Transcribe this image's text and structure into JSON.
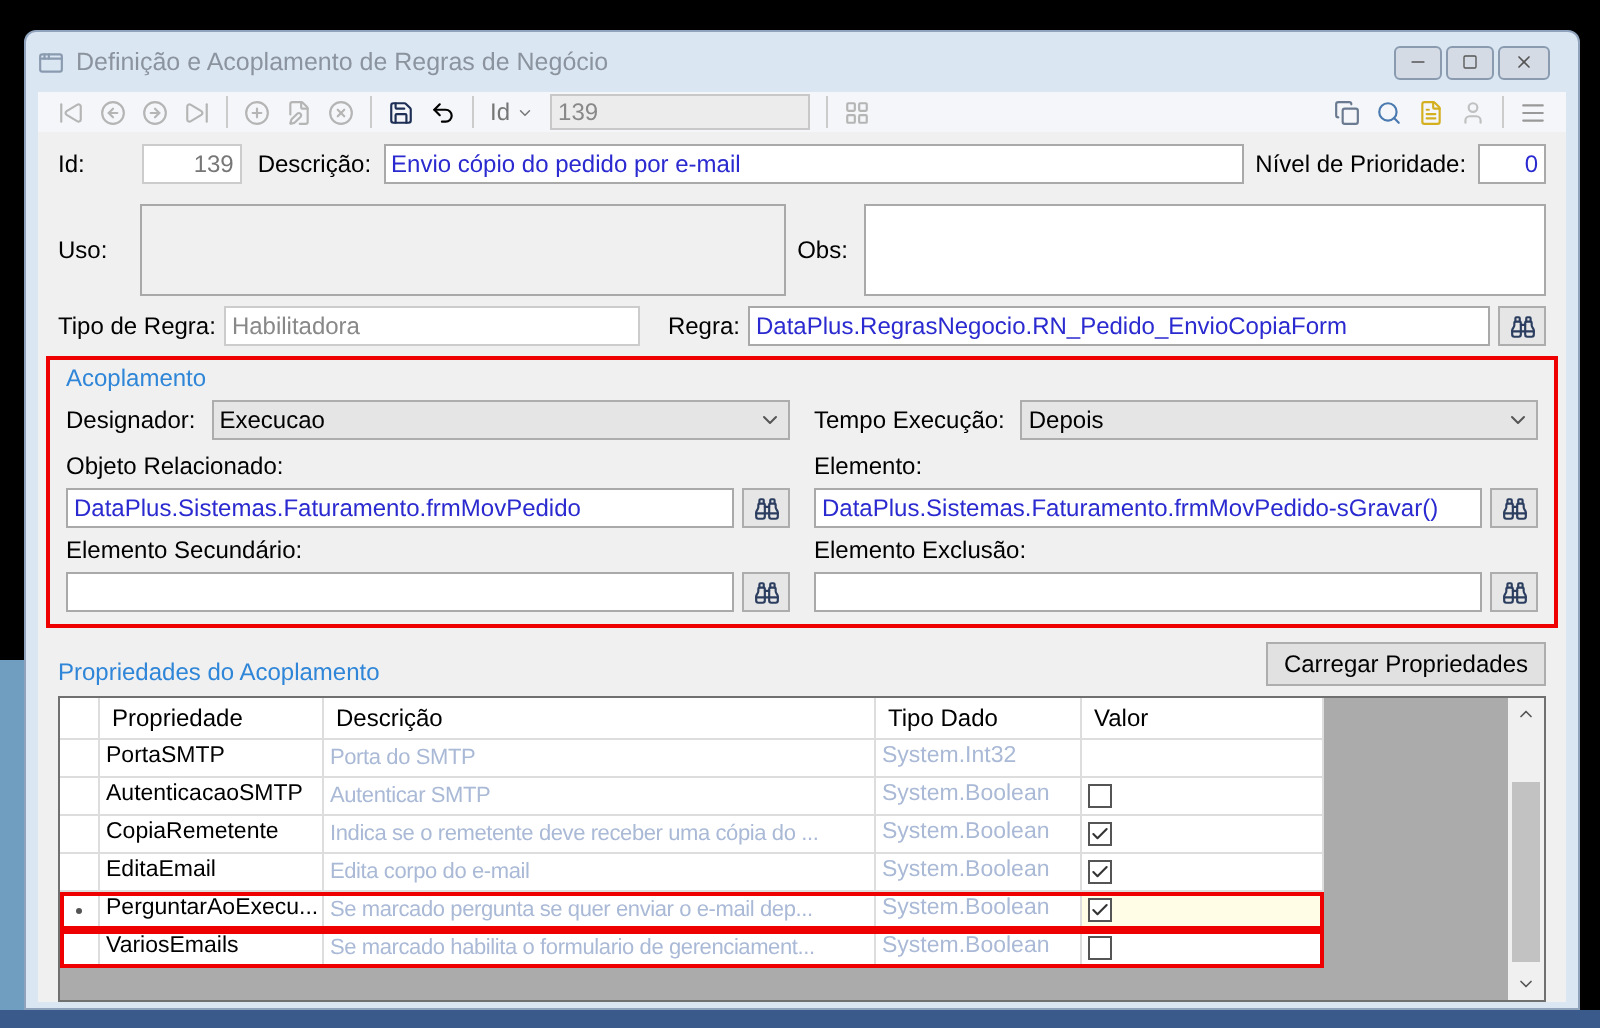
{
  "window": {
    "title": "Definição e Acoplamento de Regras de Negócio"
  },
  "toolbar": {
    "id_label": "Id",
    "id_value": "139"
  },
  "form": {
    "id_label": "Id:",
    "id_value": "139",
    "descricao_label": "Descrição:",
    "descricao_value": "Envio cópio do pedido por e-mail",
    "prioridade_label": "Nível de Prioridade:",
    "prioridade_value": "0",
    "uso_label": "Uso:",
    "obs_label": "Obs:",
    "tipo_label": "Tipo de Regra:",
    "tipo_value": "Habilitadora",
    "regra_label": "Regra:",
    "regra_value": "DataPlus.RegrasNegocio.RN_Pedido_EnvioCopiaForm"
  },
  "acoplamento": {
    "title": "Acoplamento",
    "designador_label": "Designador:",
    "designador_value": "Execucao",
    "tempo_label": "Tempo Execução:",
    "tempo_value": "Depois",
    "objeto_label": "Objeto Relacionado:",
    "objeto_value": "DataPlus.Sistemas.Faturamento.frmMovPedido",
    "elemento_label": "Elemento:",
    "elemento_value": "DataPlus.Sistemas.Faturamento.frmMovPedido-sGravar()",
    "secundario_label": "Elemento Secundário:",
    "exclusao_label": "Elemento Exclusão:"
  },
  "propriedades": {
    "title": "Propriedades do Acoplamento",
    "load_button": "Carregar Propriedades",
    "columns": [
      "Propriedade",
      "Descrição",
      "Tipo Dado",
      "Valor"
    ],
    "rows": [
      {
        "propriedade": "PortaSMTP",
        "descricao": "Porta do SMTP",
        "tipo": "System.Int32",
        "kind": "text",
        "selected": false,
        "highlighted": false
      },
      {
        "propriedade": "AutenticacaoSMTP",
        "descricao": "Autenticar SMTP",
        "tipo": "System.Boolean",
        "kind": "checkbox",
        "checked": false,
        "selected": false,
        "highlighted": false
      },
      {
        "propriedade": "CopiaRemetente",
        "descricao": "Indica se o remetente deve receber uma cópia do ...",
        "tipo": "System.Boolean",
        "kind": "checkbox",
        "checked": true,
        "selected": false,
        "highlighted": false
      },
      {
        "propriedade": "EditaEmail",
        "descricao": "Edita corpo do e-mail",
        "tipo": "System.Boolean",
        "kind": "checkbox",
        "checked": true,
        "selected": false,
        "highlighted": false
      },
      {
        "propriedade": "PerguntarAoExecu...",
        "descricao": "Se marcado pergunta se quer enviar o e-mail dep...",
        "tipo": "System.Boolean",
        "kind": "checkbox",
        "checked": true,
        "selected": true,
        "highlighted": true
      },
      {
        "propriedade": "VariosEmails",
        "descricao": "Se marcado habilita o formulario de gerenciament...",
        "tipo": "System.Boolean",
        "kind": "checkbox",
        "checked": false,
        "selected": false,
        "highlighted": true
      }
    ]
  }
}
